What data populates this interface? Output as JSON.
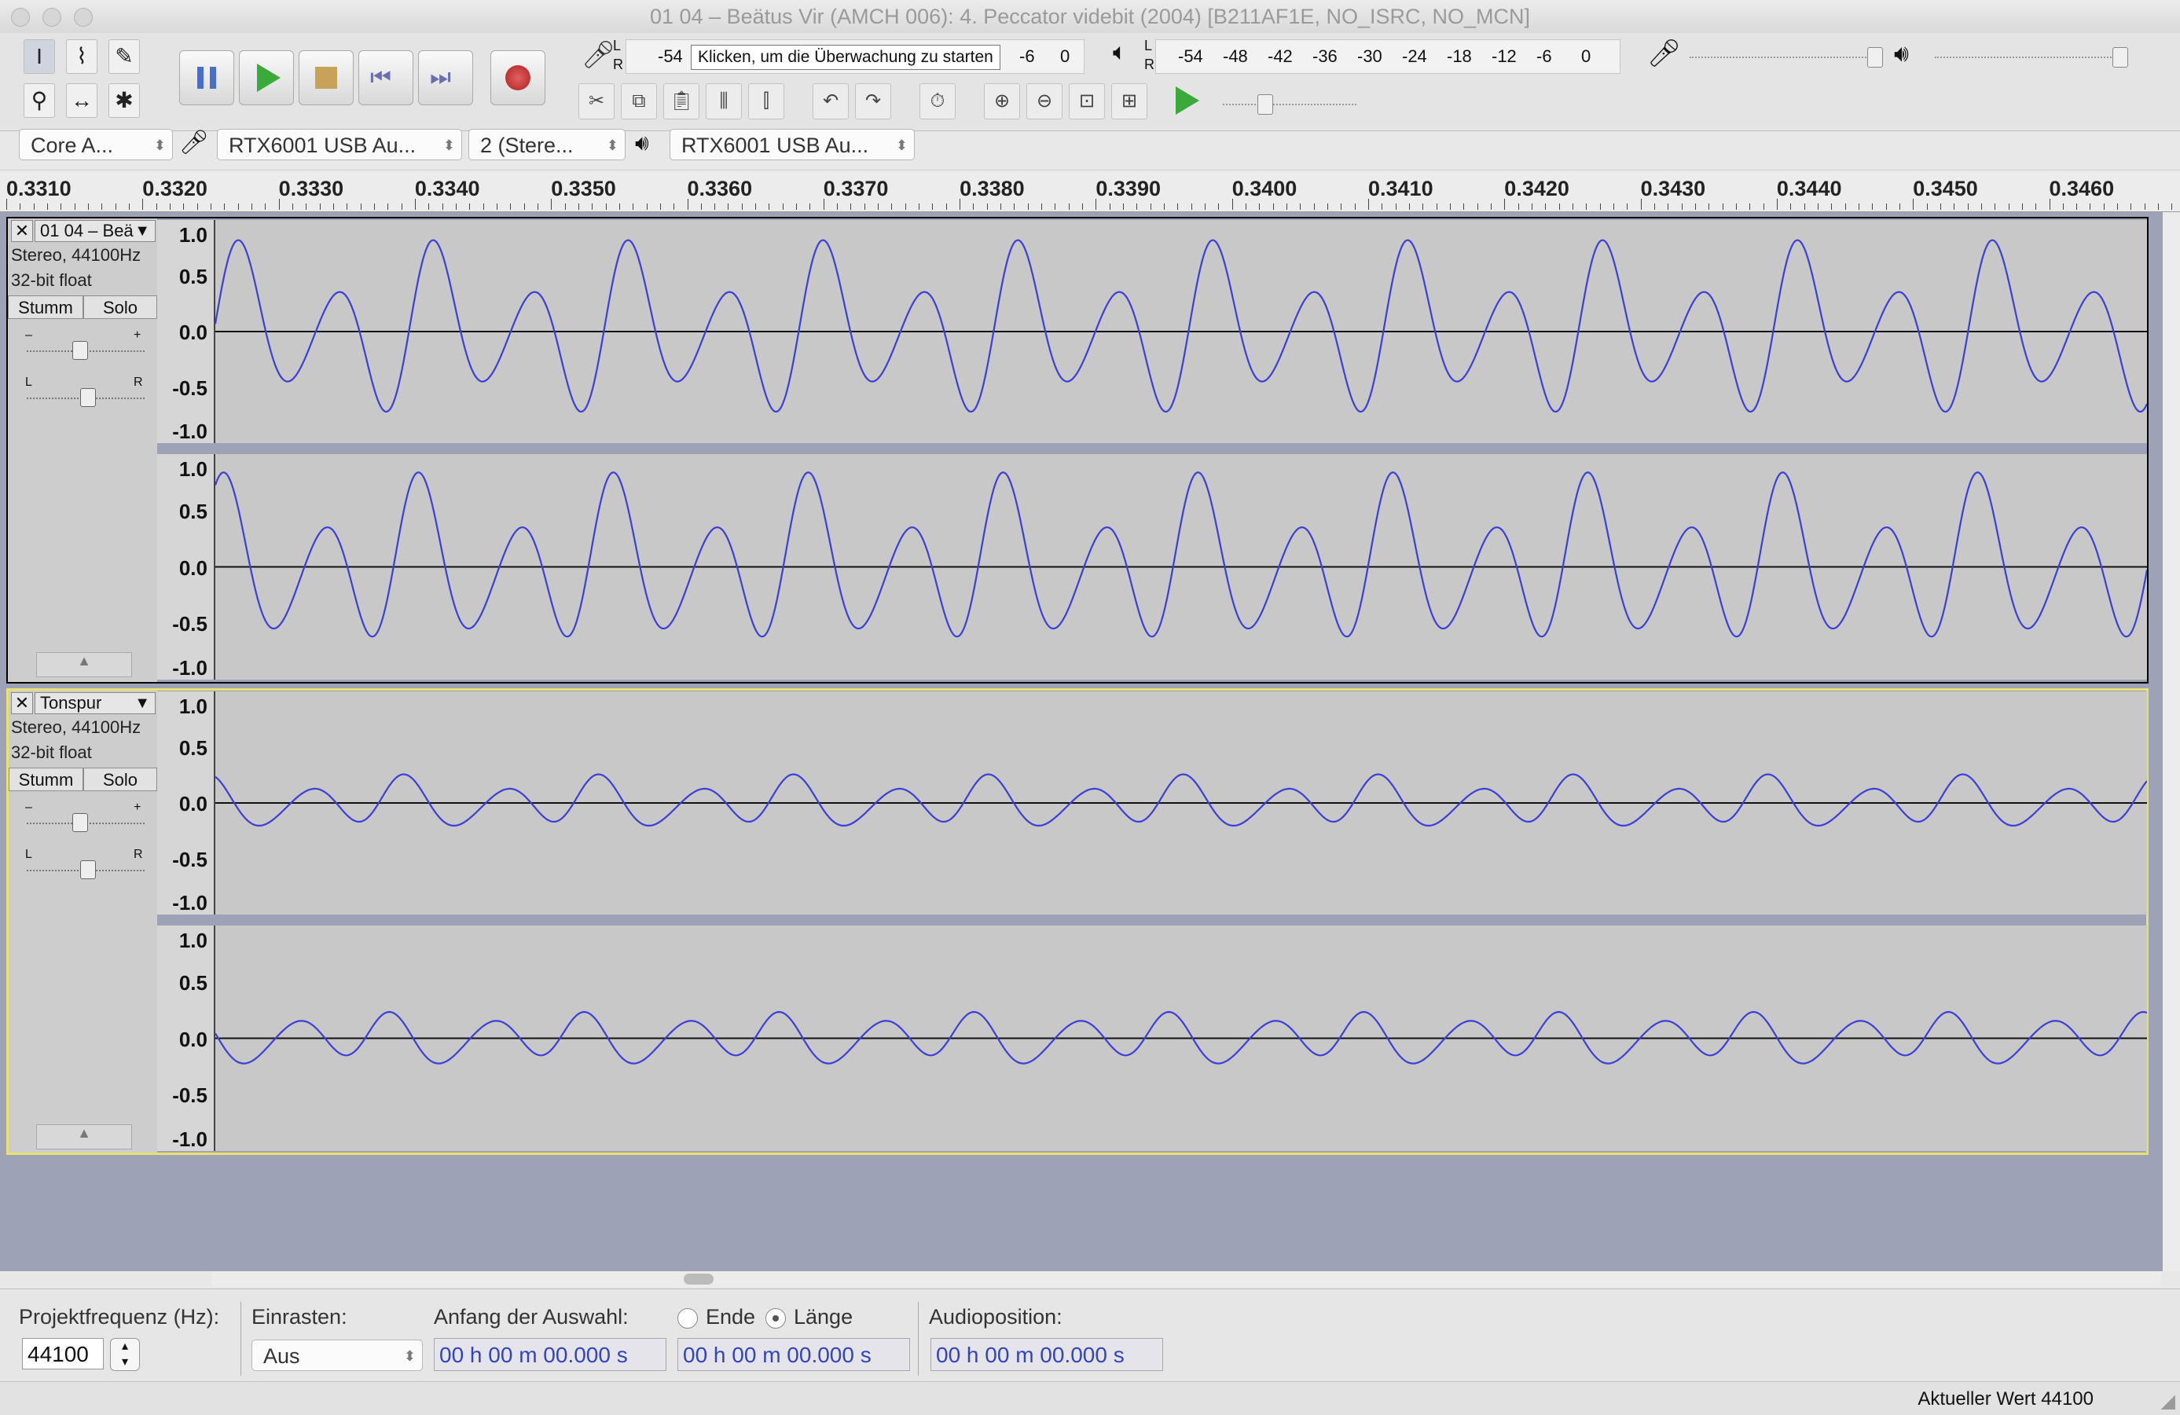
{
  "window": {
    "title": "01 04 – Beätus Vir (AMCH 006):   4. Peccator videbit (2004) [B211AF1E, NO_ISRC, NO_MCN]"
  },
  "meters": {
    "record_scale": [
      "-54",
      "-6",
      "0"
    ],
    "monitor_tooltip": "Klicken, um die Überwachung zu starten",
    "play_scale": [
      "-54",
      "-48",
      "-42",
      "-36",
      "-30",
      "-24",
      "-18",
      "-12",
      "-6",
      "0"
    ],
    "channel_l": "L",
    "channel_r": "R"
  },
  "devices": {
    "host": "Core A...",
    "input_device": "RTX6001 USB Au...",
    "input_channels": "2 (Stere...",
    "output_device": "RTX6001 USB Au..."
  },
  "ruler": {
    "ticks": [
      "0.3310",
      "0.3320",
      "0.3330",
      "0.3340",
      "0.3350",
      "0.3360",
      "0.3370",
      "0.3380",
      "0.3390",
      "0.3400",
      "0.3410",
      "0.3420",
      "0.3430",
      "0.3440",
      "0.3450",
      "0.3460"
    ]
  },
  "tracks": [
    {
      "name": "01 04 – Beä",
      "format": "Stereo, 44100Hz",
      "bits": "32-bit float",
      "mute": "Stumm",
      "solo": "Solo",
      "scale": [
        "1.0",
        "0.5",
        "0.0",
        "-0.5",
        "-1.0"
      ]
    },
    {
      "name": "Tonspur",
      "format": "Stereo, 44100Hz",
      "bits": "32-bit float",
      "mute": "Stumm",
      "solo": "Solo",
      "scale": [
        "1.0",
        "0.5",
        "0.0",
        "-0.5",
        "-1.0"
      ]
    }
  ],
  "slider_marks": {
    "minus": "–",
    "plus": "+",
    "left": "L",
    "right": "R"
  },
  "selection": {
    "rate_label": "Projektfrequenz (Hz):",
    "rate_value": "44100",
    "snap_label": "Einrasten:",
    "snap_value": "Aus",
    "start_label": "Anfang der Auswahl:",
    "end_option": "Ende",
    "length_option": "Länge",
    "audio_pos_label": "Audioposition:",
    "time_value": "00 h 00 m 00.000 s"
  },
  "status": {
    "text": "Aktueller Wert 44100"
  },
  "colors": {
    "waveform": "#3b3fd6",
    "selected_track_border": "#e8e070",
    "track_background": "#9ea2b7"
  }
}
